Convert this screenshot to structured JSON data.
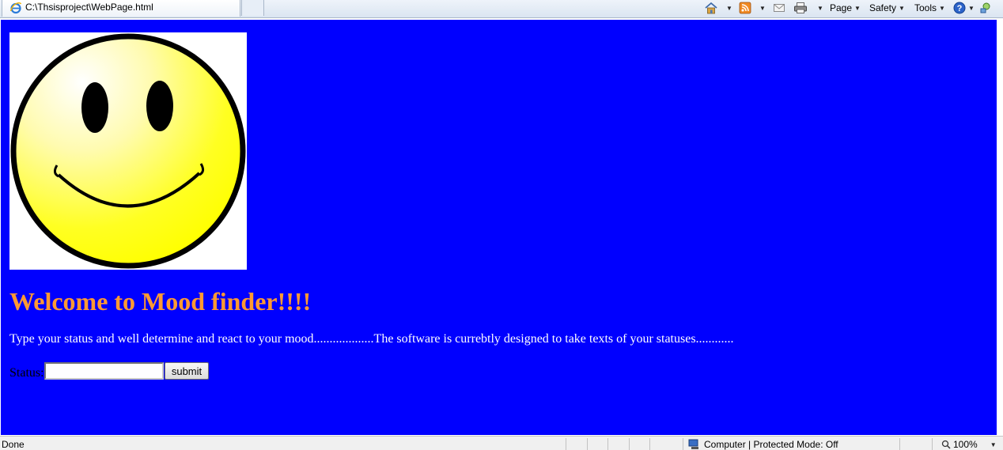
{
  "browser": {
    "tab_title": "C:\\Thsisproject\\WebPage.html",
    "toolbar": {
      "home_icon": "home-icon",
      "feeds_icon": "rss-feed-icon",
      "mail_icon": "mail-icon",
      "print_icon": "printer-icon",
      "page_label": "Page",
      "safety_label": "Safety",
      "tools_label": "Tools",
      "help_icon": "help-icon",
      "research_icon": "research-icon"
    }
  },
  "page": {
    "background_color": "#0000ff",
    "image": "smiley-face",
    "heading": "Welcome to Mood finder!!!!",
    "heading_color": "#ff9933",
    "description": "Type your status and well determine and react to your mood...................The software is currebtly designed to take texts of your statuses............",
    "form": {
      "status_label": "Status:",
      "status_value": "",
      "submit_label": "submit"
    }
  },
  "statusbar": {
    "status_text": "Done",
    "zone_text": "Computer | Protected Mode: Off",
    "zoom_text": "100%"
  }
}
